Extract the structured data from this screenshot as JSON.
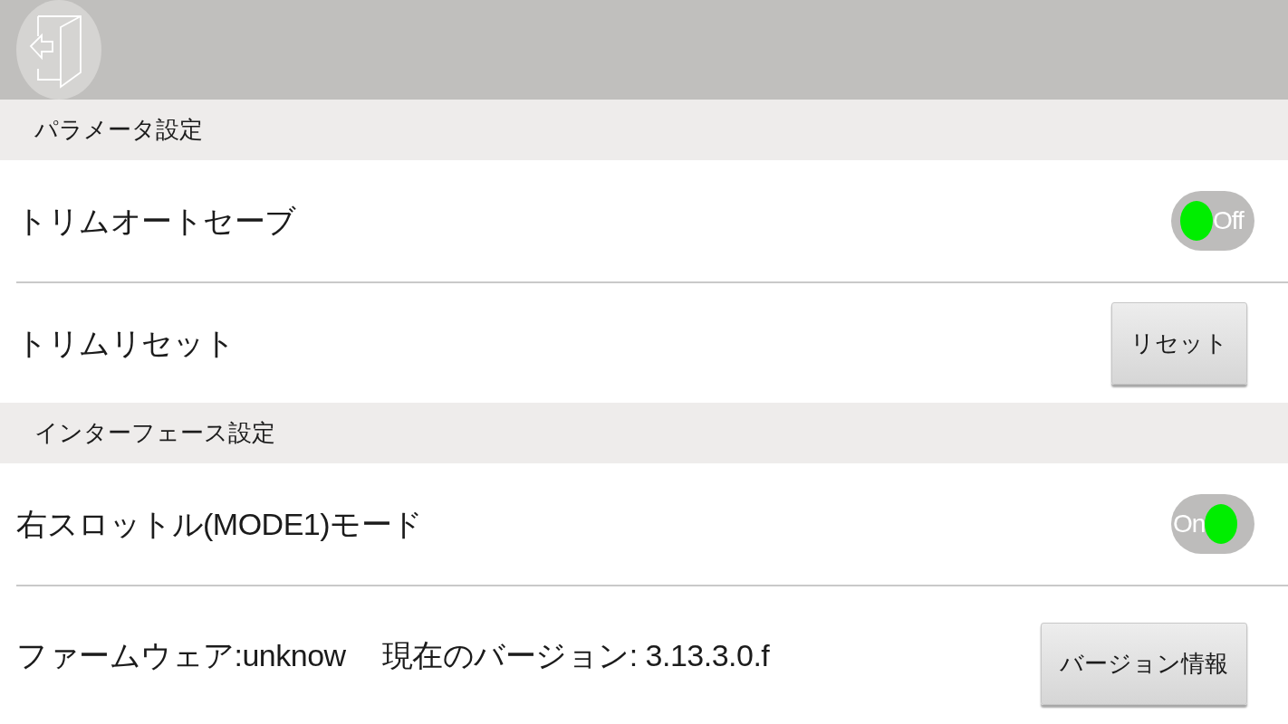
{
  "sections": [
    {
      "title": "パラメータ設定",
      "rows": [
        {
          "kind": "toggle",
          "label": "トリムオートセーブ",
          "on": false,
          "state_text": "Off"
        },
        {
          "kind": "button",
          "label": "トリムリセット",
          "button": "リセット"
        }
      ]
    },
    {
      "title": "インターフェース設定",
      "rows": [
        {
          "kind": "toggle",
          "label": "右スロットル(MODE1)モード",
          "on": true,
          "state_text": "On"
        },
        {
          "kind": "button",
          "label": "ファームウェア:unknow",
          "detail": "現在のバージョン: 3.13.3.0.f",
          "button": "バージョン情報"
        }
      ]
    }
  ]
}
